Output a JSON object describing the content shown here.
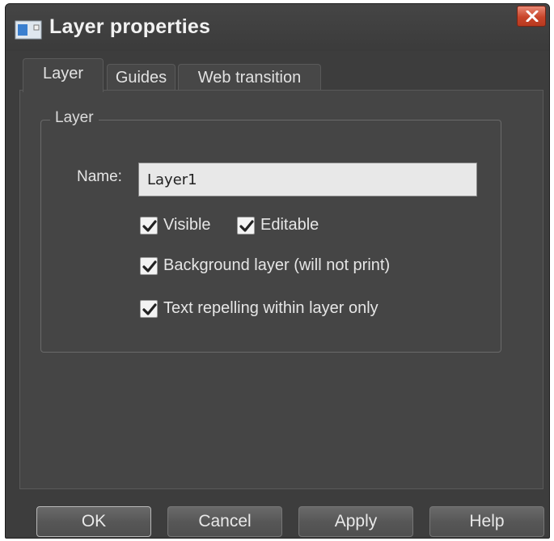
{
  "window": {
    "title": "Layer properties",
    "icon": "layer-properties-icon",
    "close_icon": "close-icon"
  },
  "tabs": [
    {
      "label": "Layer",
      "active": true
    },
    {
      "label": "Guides",
      "active": false
    },
    {
      "label": "Web transition",
      "active": false
    }
  ],
  "group": {
    "legend": "Layer",
    "name_label": "Name:",
    "name_value": "Layer1"
  },
  "checkboxes": [
    {
      "label": "Visible",
      "checked": true
    },
    {
      "label": "Editable",
      "checked": true
    },
    {
      "label": "Background layer (will not print)",
      "checked": true
    },
    {
      "label": "Text repelling within layer only",
      "checked": true
    }
  ],
  "buttons": {
    "ok": "OK",
    "cancel": "Cancel",
    "apply": "Apply",
    "help": "Help"
  },
  "colors": {
    "dialog_bg": "#3d3d3d",
    "panel_bg": "#454545",
    "close_button": "#c9452a",
    "input_bg": "#e8e8e8"
  }
}
